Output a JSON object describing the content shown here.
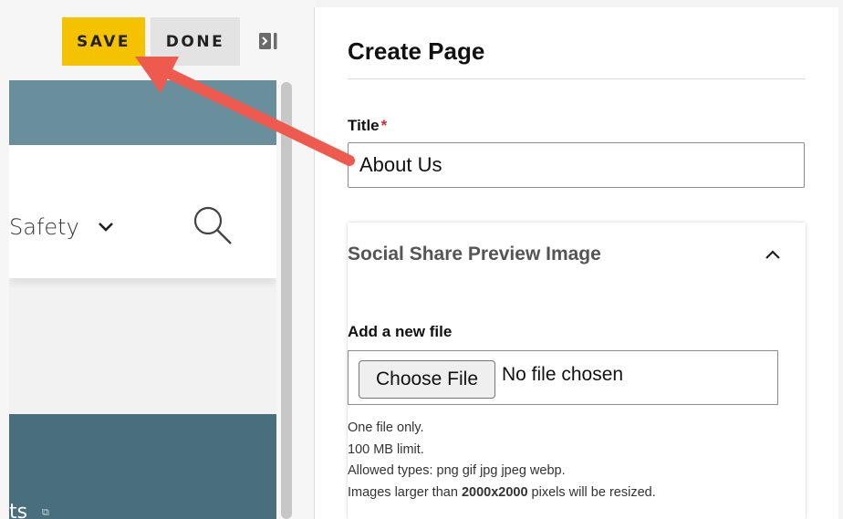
{
  "toolbar": {
    "save_label": "SAVE",
    "done_label": "DONE",
    "collapse_icon": "sidebar-collapse-icon"
  },
  "preview": {
    "nav_text": "Safety",
    "band_text": "ts",
    "icons": [
      "chevron-down-icon",
      "search-icon",
      "external-link-icon"
    ],
    "colors": {
      "band_top": "#6a8f9c",
      "band_bottom": "#4a6f7c"
    }
  },
  "panel": {
    "title": "Create Page",
    "title_field": {
      "label": "Title",
      "required_marker": "*",
      "value": "About Us"
    },
    "social_share": {
      "heading": "Social Share Preview Image",
      "expanded": true,
      "add_file_label": "Add a new file",
      "choose_button": "Choose File",
      "no_file_text": "No file chosen",
      "help": {
        "line1": "One file only.",
        "line2": "100 MB limit.",
        "line3": "Allowed types: png gif jpg jpeg webp.",
        "line4_prefix": "Images larger than ",
        "line4_bold": "2000x2000",
        "line4_suffix": " pixels will be resized."
      }
    }
  },
  "colors": {
    "save_button": "#f5c200",
    "done_button": "#e3e3e3",
    "required": "#d62a2a",
    "annotation_arrow": "#ee5a4e"
  }
}
